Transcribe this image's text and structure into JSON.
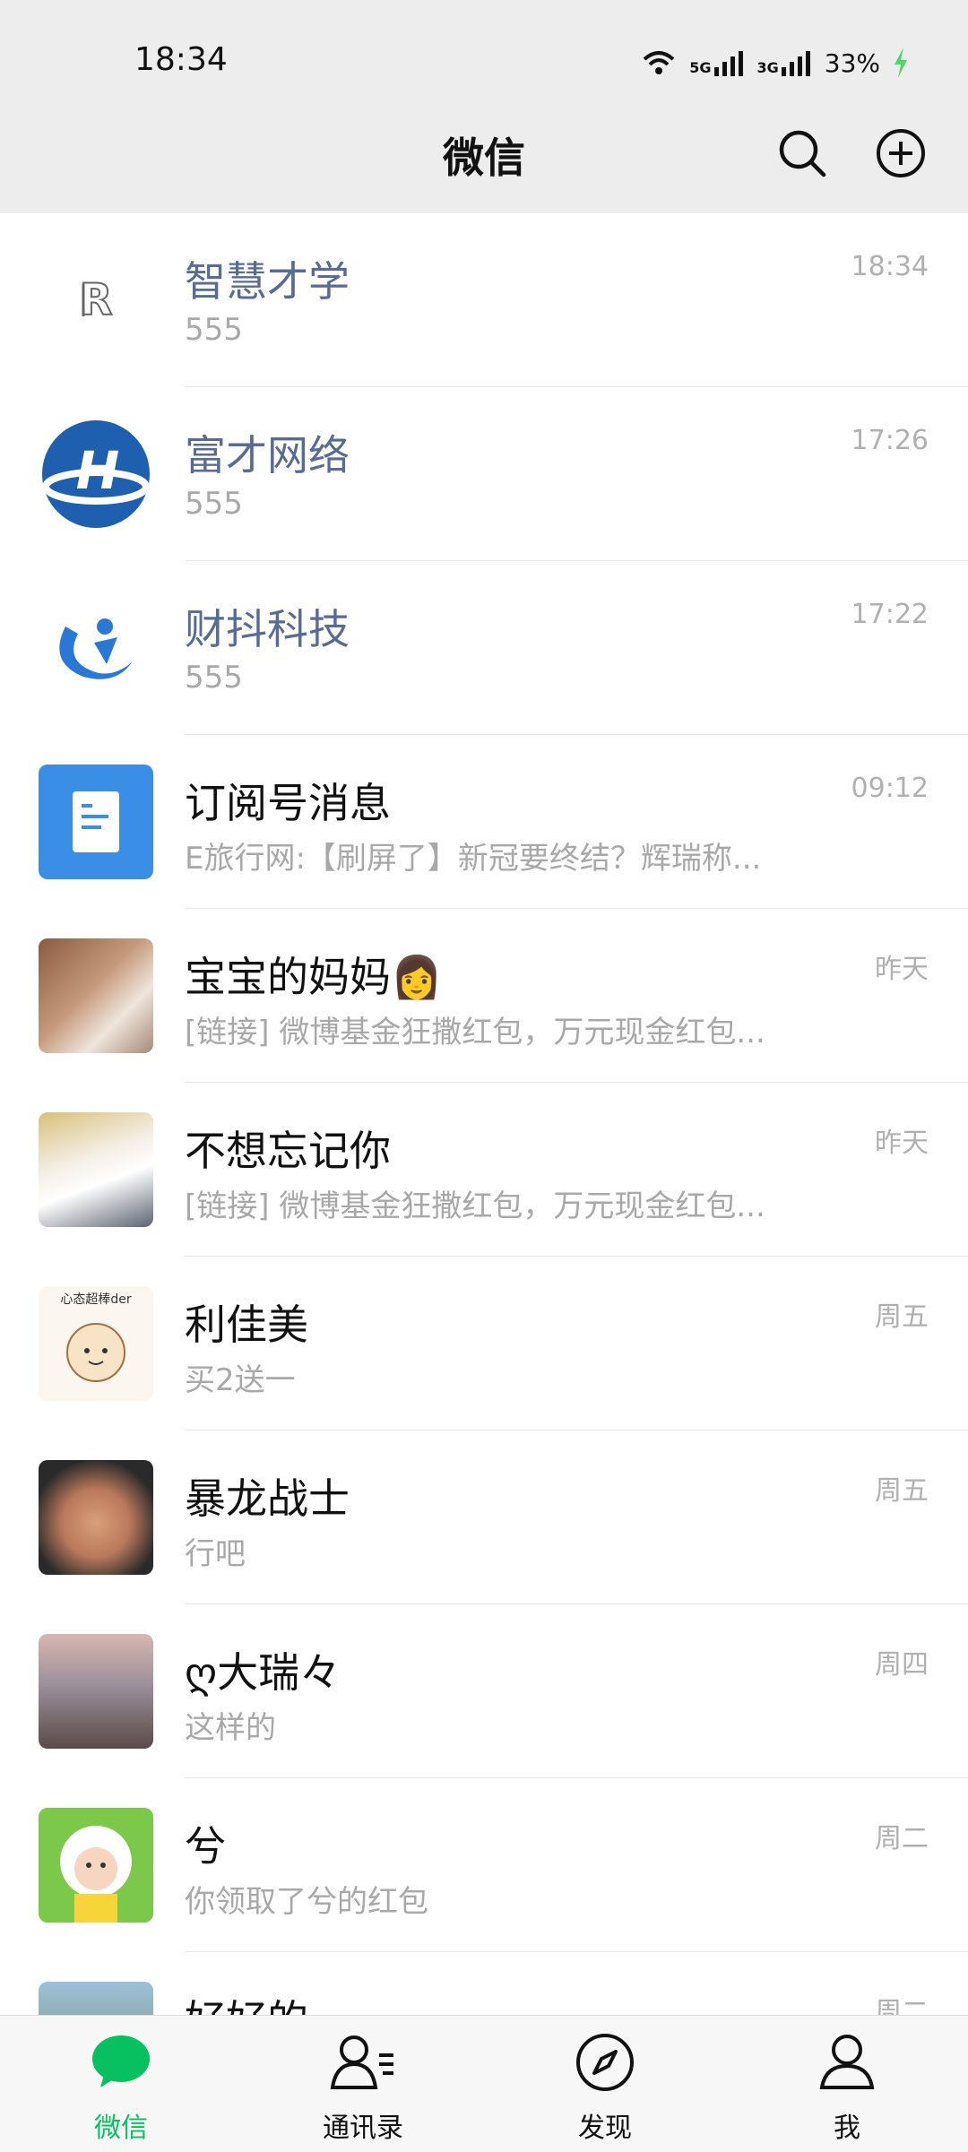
{
  "status_bar": {
    "time": "18:34",
    "network_5g": "5G",
    "network_3g": "3G",
    "battery": "33%",
    "icons": [
      "wifi-icon",
      "signal-icon",
      "battery-charging-icon"
    ]
  },
  "header": {
    "title": "微信",
    "icons": [
      "search-icon",
      "add-circle-icon"
    ]
  },
  "chats": [
    {
      "name": "智慧才学",
      "preview": "555",
      "time": "18:34",
      "official": true
    },
    {
      "name": "富才网络",
      "preview": "555",
      "time": "17:26",
      "official": true
    },
    {
      "name": "财抖科技",
      "preview": "555",
      "time": "17:22",
      "official": true
    },
    {
      "name": "订阅号消息",
      "preview": "E旅行网:【刷屏了】新冠要终结？辉瑞称...",
      "time": "09:12"
    },
    {
      "name": "宝宝的妈妈",
      "emoji": "👩",
      "preview": "[链接] 微博基金狂撒红包，万元现金红包...",
      "time": "昨天"
    },
    {
      "name": "不想忘记你",
      "preview": "[链接] 微博基金狂撒红包，万元现金红包...",
      "time": "昨天"
    },
    {
      "name": "利佳美",
      "preview": "买2送一",
      "time": "周五",
      "avatar_text": "心态超棒der"
    },
    {
      "name": "暴龙战士",
      "preview": "行吧",
      "time": "周五"
    },
    {
      "name": "ღ大瑞々",
      "preview": "这样的",
      "time": "周四"
    },
    {
      "name": "兮",
      "preview": "你领取了兮的红包",
      "time": "周二"
    },
    {
      "name": "好好的",
      "preview": "",
      "time": "周二"
    }
  ],
  "tabbar": {
    "tabs": [
      {
        "label": "微信",
        "icon": "chat-bubble-icon",
        "active": true
      },
      {
        "label": "通讯录",
        "icon": "contacts-icon"
      },
      {
        "label": "发现",
        "icon": "compass-icon"
      },
      {
        "label": "我",
        "icon": "person-icon"
      }
    ]
  },
  "colors": {
    "accent": "#07c160",
    "official_name": "#576b95",
    "header_bg": "#ededed"
  }
}
